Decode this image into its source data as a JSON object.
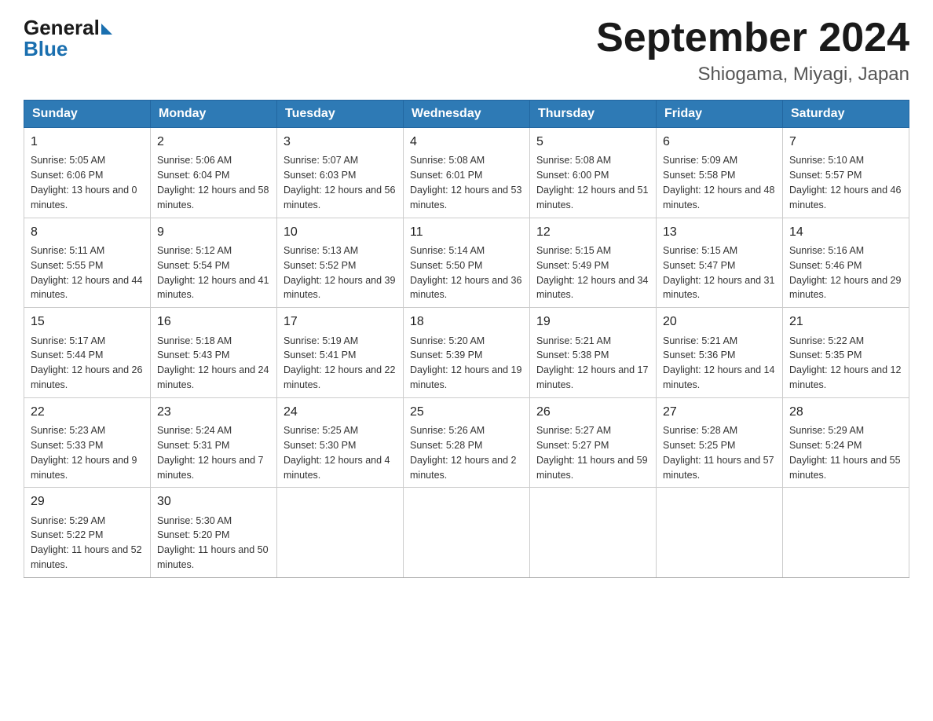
{
  "header": {
    "logo_general": "General",
    "logo_blue": "Blue",
    "title": "September 2024",
    "subtitle": "Shiogama, Miyagi, Japan"
  },
  "calendar": {
    "headers": [
      "Sunday",
      "Monday",
      "Tuesday",
      "Wednesday",
      "Thursday",
      "Friday",
      "Saturday"
    ],
    "weeks": [
      [
        null,
        null,
        null,
        null,
        {
          "day": "1",
          "sunrise": "5:05 AM",
          "sunset": "6:06 PM",
          "daylight": "13 hours and 0 minutes."
        },
        {
          "day": "2",
          "sunrise": "5:06 AM",
          "sunset": "6:04 PM",
          "daylight": "12 hours and 58 minutes."
        },
        {
          "day": "3",
          "sunrise": "5:07 AM",
          "sunset": "6:03 PM",
          "daylight": "12 hours and 56 minutes."
        },
        {
          "day": "4",
          "sunrise": "5:08 AM",
          "sunset": "6:01 PM",
          "daylight": "12 hours and 53 minutes."
        },
        {
          "day": "5",
          "sunrise": "5:08 AM",
          "sunset": "6:00 PM",
          "daylight": "12 hours and 51 minutes."
        },
        {
          "day": "6",
          "sunrise": "5:09 AM",
          "sunset": "5:58 PM",
          "daylight": "12 hours and 48 minutes."
        },
        {
          "day": "7",
          "sunrise": "5:10 AM",
          "sunset": "5:57 PM",
          "daylight": "12 hours and 46 minutes."
        }
      ],
      [
        {
          "day": "8",
          "sunrise": "5:11 AM",
          "sunset": "5:55 PM",
          "daylight": "12 hours and 44 minutes."
        },
        {
          "day": "9",
          "sunrise": "5:12 AM",
          "sunset": "5:54 PM",
          "daylight": "12 hours and 41 minutes."
        },
        {
          "day": "10",
          "sunrise": "5:13 AM",
          "sunset": "5:52 PM",
          "daylight": "12 hours and 39 minutes."
        },
        {
          "day": "11",
          "sunrise": "5:14 AM",
          "sunset": "5:50 PM",
          "daylight": "12 hours and 36 minutes."
        },
        {
          "day": "12",
          "sunrise": "5:15 AM",
          "sunset": "5:49 PM",
          "daylight": "12 hours and 34 minutes."
        },
        {
          "day": "13",
          "sunrise": "5:15 AM",
          "sunset": "5:47 PM",
          "daylight": "12 hours and 31 minutes."
        },
        {
          "day": "14",
          "sunrise": "5:16 AM",
          "sunset": "5:46 PM",
          "daylight": "12 hours and 29 minutes."
        }
      ],
      [
        {
          "day": "15",
          "sunrise": "5:17 AM",
          "sunset": "5:44 PM",
          "daylight": "12 hours and 26 minutes."
        },
        {
          "day": "16",
          "sunrise": "5:18 AM",
          "sunset": "5:43 PM",
          "daylight": "12 hours and 24 minutes."
        },
        {
          "day": "17",
          "sunrise": "5:19 AM",
          "sunset": "5:41 PM",
          "daylight": "12 hours and 22 minutes."
        },
        {
          "day": "18",
          "sunrise": "5:20 AM",
          "sunset": "5:39 PM",
          "daylight": "12 hours and 19 minutes."
        },
        {
          "day": "19",
          "sunrise": "5:21 AM",
          "sunset": "5:38 PM",
          "daylight": "12 hours and 17 minutes."
        },
        {
          "day": "20",
          "sunrise": "5:21 AM",
          "sunset": "5:36 PM",
          "daylight": "12 hours and 14 minutes."
        },
        {
          "day": "21",
          "sunrise": "5:22 AM",
          "sunset": "5:35 PM",
          "daylight": "12 hours and 12 minutes."
        }
      ],
      [
        {
          "day": "22",
          "sunrise": "5:23 AM",
          "sunset": "5:33 PM",
          "daylight": "12 hours and 9 minutes."
        },
        {
          "day": "23",
          "sunrise": "5:24 AM",
          "sunset": "5:31 PM",
          "daylight": "12 hours and 7 minutes."
        },
        {
          "day": "24",
          "sunrise": "5:25 AM",
          "sunset": "5:30 PM",
          "daylight": "12 hours and 4 minutes."
        },
        {
          "day": "25",
          "sunrise": "5:26 AM",
          "sunset": "5:28 PM",
          "daylight": "12 hours and 2 minutes."
        },
        {
          "day": "26",
          "sunrise": "5:27 AM",
          "sunset": "5:27 PM",
          "daylight": "11 hours and 59 minutes."
        },
        {
          "day": "27",
          "sunrise": "5:28 AM",
          "sunset": "5:25 PM",
          "daylight": "11 hours and 57 minutes."
        },
        {
          "day": "28",
          "sunrise": "5:29 AM",
          "sunset": "5:24 PM",
          "daylight": "11 hours and 55 minutes."
        }
      ],
      [
        {
          "day": "29",
          "sunrise": "5:29 AM",
          "sunset": "5:22 PM",
          "daylight": "11 hours and 52 minutes."
        },
        {
          "day": "30",
          "sunrise": "5:30 AM",
          "sunset": "5:20 PM",
          "daylight": "11 hours and 50 minutes."
        },
        null,
        null,
        null,
        null,
        null
      ]
    ]
  }
}
